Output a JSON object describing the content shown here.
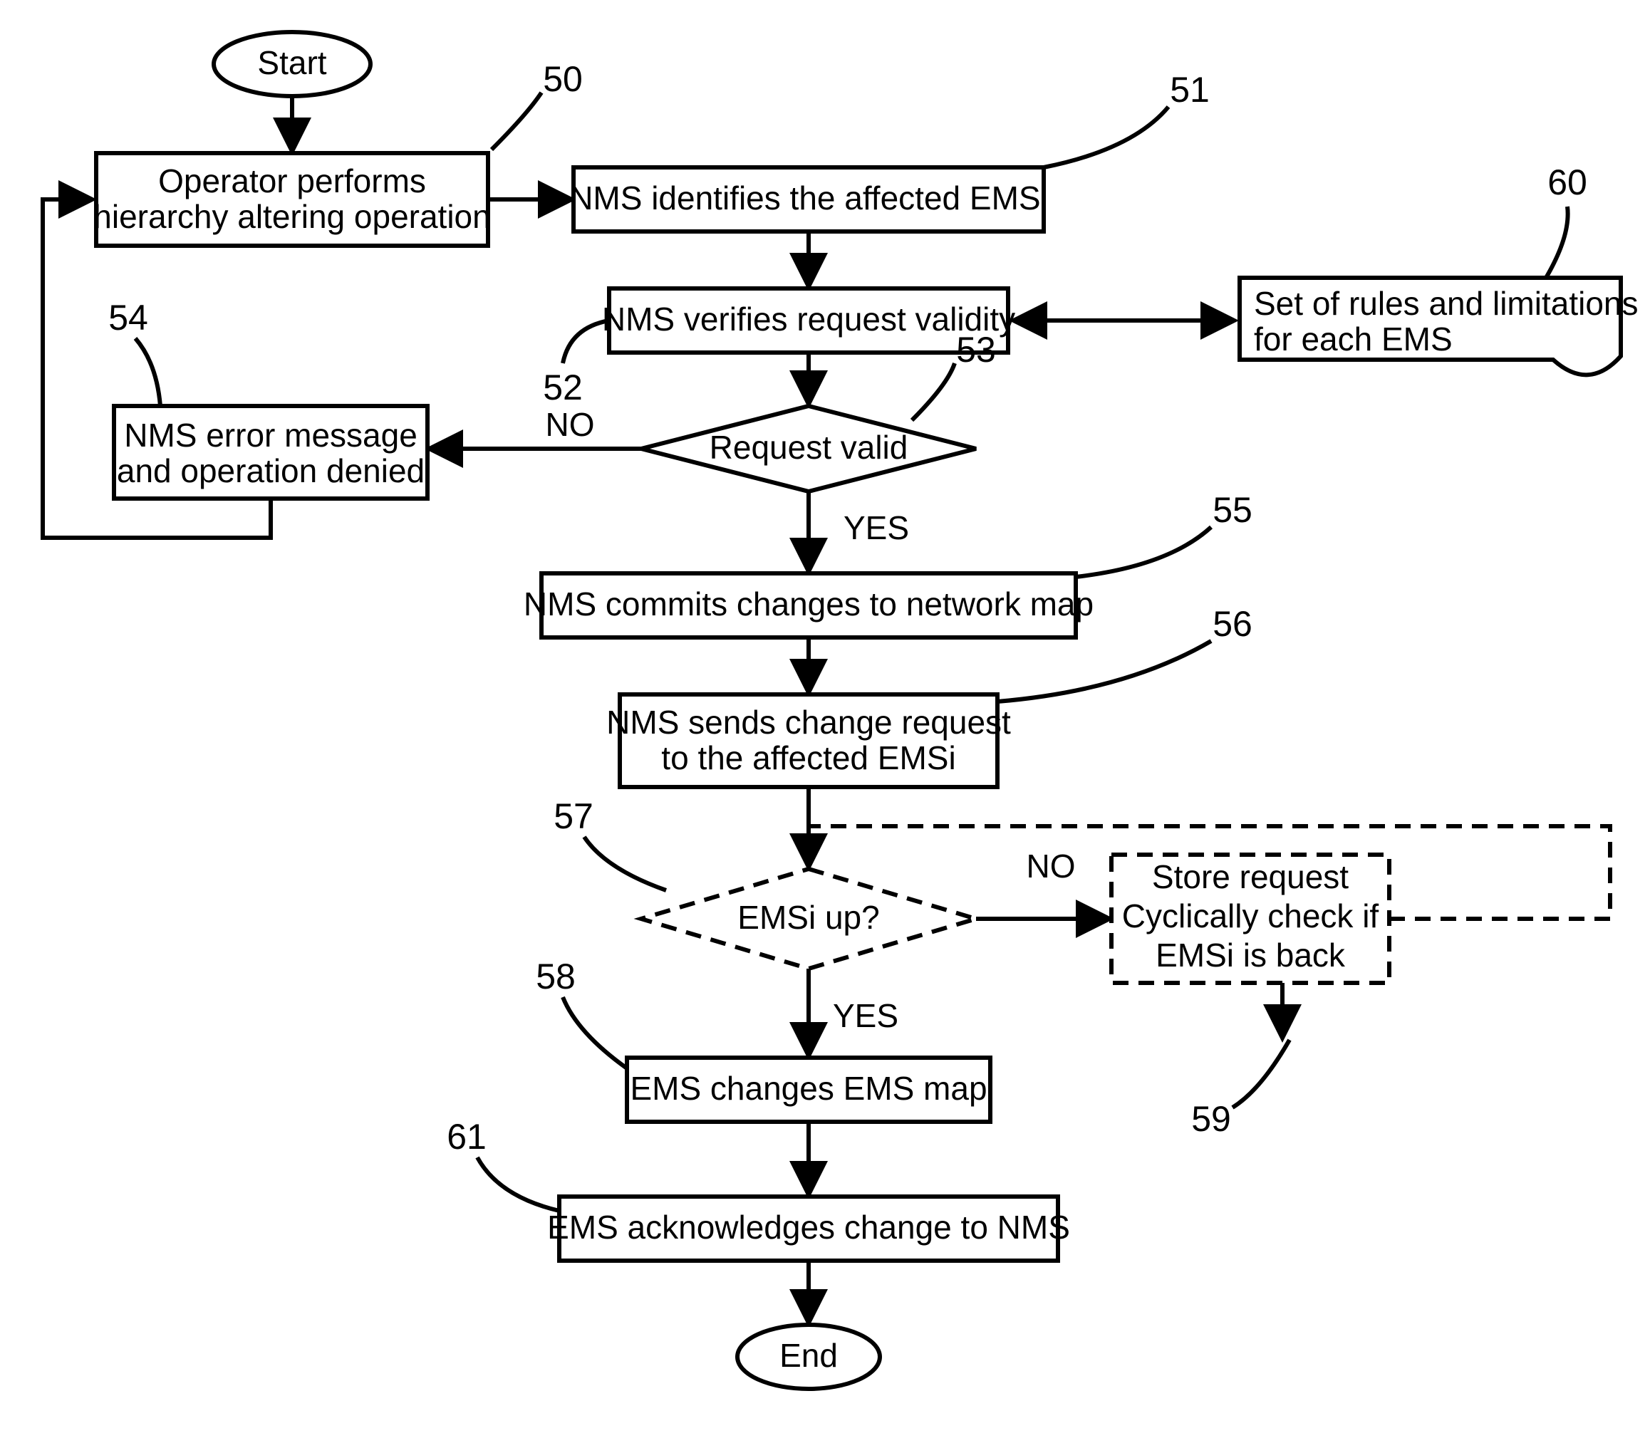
{
  "chart_data": {
    "type": "flowchart",
    "nodes": [
      {
        "id": "start",
        "shape": "terminator",
        "text": "Start"
      },
      {
        "id": "50",
        "shape": "process",
        "text": "Operator performs hierarchy altering operation",
        "label": "50"
      },
      {
        "id": "51",
        "shape": "process",
        "text": "NMS identifies the affected EMSi",
        "label": "51"
      },
      {
        "id": "52",
        "shape": "process",
        "text": "NMS verifies request validity",
        "label": "52"
      },
      {
        "id": "60",
        "shape": "document",
        "text": "Set of rules and limitations for each EMS",
        "label": "60"
      },
      {
        "id": "53",
        "shape": "decision",
        "text": "Request valid",
        "label": "53"
      },
      {
        "id": "54",
        "shape": "process",
        "text": "NMS error message and operation denied",
        "label": "54"
      },
      {
        "id": "55",
        "shape": "process",
        "text": "NMS commits changes to network map",
        "label": "55"
      },
      {
        "id": "56",
        "shape": "process",
        "text": "NMS sends change request to the affected EMSi",
        "label": "56"
      },
      {
        "id": "57",
        "shape": "decision",
        "text": "EMSi up?",
        "label": "57",
        "dashed": true
      },
      {
        "id": "59",
        "shape": "process",
        "text": "Store request Cyclically check if EMSi is back",
        "label": "59",
        "dashed": true
      },
      {
        "id": "58",
        "shape": "process",
        "text": "EMS changes EMS map",
        "label": "58"
      },
      {
        "id": "61",
        "shape": "process",
        "text": "EMS acknowledges change to NMS",
        "label": "61"
      },
      {
        "id": "end",
        "shape": "terminator",
        "text": "End"
      }
    ],
    "edges": [
      {
        "from": "start",
        "to": "50"
      },
      {
        "from": "50",
        "to": "51"
      },
      {
        "from": "51",
        "to": "52"
      },
      {
        "from": "52",
        "to": "60",
        "bidir": true
      },
      {
        "from": "52",
        "to": "53"
      },
      {
        "from": "53",
        "to": "54",
        "label": "NO"
      },
      {
        "from": "54",
        "to": "50",
        "loopback": true
      },
      {
        "from": "53",
        "to": "55",
        "label": "YES"
      },
      {
        "from": "55",
        "to": "56"
      },
      {
        "from": "56",
        "to": "57"
      },
      {
        "from": "57",
        "to": "59",
        "label": "NO"
      },
      {
        "from": "59",
        "to": "57",
        "loopback": true
      },
      {
        "from": "57",
        "to": "58",
        "label": "YES"
      },
      {
        "from": "58",
        "to": "61"
      },
      {
        "from": "61",
        "to": "end"
      }
    ],
    "branch_labels": {
      "yes": "YES",
      "no": "NO"
    }
  },
  "labels": {
    "start": "Start",
    "end": "End",
    "n50a": "Operator performs",
    "n50b": "hierarchy altering operation",
    "n51": "NMS identifies the affected EMSi",
    "n52": "NMS verifies request validity",
    "n53": "Request valid",
    "n54a": "NMS  error message",
    "n54b": "and operation denied",
    "n55": "NMS commits changes to network map",
    "n56a": "NMS sends change request",
    "n56b": "to the affected EMSi",
    "n57": "EMSi up?",
    "n58": "EMS changes EMS map",
    "n59a": "Store request",
    "n59b": "Cyclically check if",
    "n59c": "EMSi is back",
    "n60a": "Set of rules and limitations",
    "n60b": "for each EMS",
    "n61": "EMS acknowledges change to NMS",
    "yes": "YES",
    "no": "NO",
    "num50": "50",
    "num51": "51",
    "num52": "52",
    "num53": "53",
    "num54": "54",
    "num55": "55",
    "num56": "56",
    "num57": "57",
    "num58": "58",
    "num59": "59",
    "num60": "60",
    "num61": "61"
  }
}
